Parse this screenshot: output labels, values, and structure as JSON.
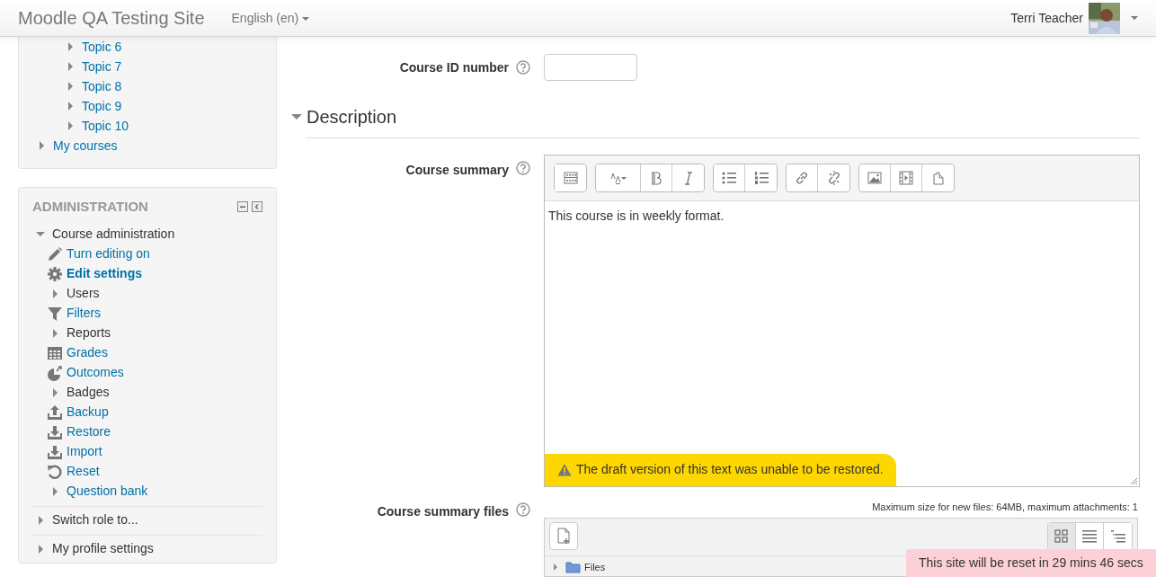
{
  "navbar": {
    "site_name": "Moodle QA Testing Site",
    "language": "English (en)",
    "user_name": "Terri Teacher"
  },
  "navigation": {
    "topics": [
      {
        "label": "Topic 6",
        "expanded": false
      },
      {
        "label": "Topic 7",
        "expanded": false
      },
      {
        "label": "Topic 8",
        "expanded": false
      },
      {
        "label": "Topic 9",
        "expanded": false
      },
      {
        "label": "Topic 10",
        "expanded": false
      }
    ],
    "items": [
      {
        "label": "My courses",
        "expanded": false
      }
    ]
  },
  "administration": {
    "title": "ADMINISTRATION",
    "items": [
      {
        "label": "Course administration",
        "expanded": true,
        "children": [
          {
            "label": "Turn editing on",
            "kind": "pencil",
            "link": true,
            "selected": false
          },
          {
            "label": "Edit settings",
            "kind": "gear",
            "link": true,
            "selected": true
          },
          {
            "label": "Users",
            "kind": "branch",
            "link": false,
            "selected": false
          },
          {
            "label": "Filters",
            "kind": "filter",
            "link": true,
            "selected": false
          },
          {
            "label": "Reports",
            "kind": "branch",
            "link": false,
            "selected": false
          },
          {
            "label": "Grades",
            "kind": "grades",
            "link": true,
            "selected": false
          },
          {
            "label": "Outcomes",
            "kind": "outcomes",
            "link": true,
            "selected": false
          },
          {
            "label": "Badges",
            "kind": "branch",
            "link": false,
            "selected": false
          },
          {
            "label": "Backup",
            "kind": "backup",
            "link": true,
            "selected": false
          },
          {
            "label": "Restore",
            "kind": "restore",
            "link": true,
            "selected": false
          },
          {
            "label": "Import",
            "kind": "import",
            "link": true,
            "selected": false
          },
          {
            "label": "Reset",
            "kind": "reset",
            "link": true,
            "selected": false
          },
          {
            "label": "Question bank",
            "kind": "branch",
            "link": true,
            "selected": false
          }
        ]
      },
      {
        "label": "Switch role to...",
        "expanded": false
      },
      {
        "label": "My profile settings",
        "expanded": false
      }
    ]
  },
  "form": {
    "id_field": {
      "label": "Course ID number"
    },
    "section": {
      "title": "Description",
      "expanded": true
    },
    "summary": {
      "label": "Course summary",
      "content": "This course is in weekly format.",
      "warning": "The draft version of this text was unable to be restored."
    },
    "files": {
      "label": "Course summary files",
      "note": "Maximum size for new files: 64MB, maximum attachments: 1",
      "views": [
        {
          "selected": true
        },
        {
          "selected": false
        },
        {
          "selected": false
        }
      ],
      "tree": [
        {
          "label": "Files",
          "expanded": false
        }
      ]
    }
  },
  "banner": "This site will be reset in 29 mins 46 secs"
}
